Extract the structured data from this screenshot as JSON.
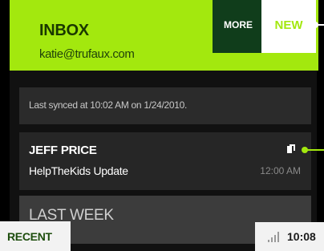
{
  "header": {
    "title": "INBOX",
    "account": "katie@trufaux.com",
    "accent_color": "#a3e80e"
  },
  "actions": {
    "more_label": "MORE",
    "new_label": "NEW"
  },
  "sync": {
    "status_text": "Last synced at 10:02 AM on 1/24/2010."
  },
  "messages": [
    {
      "sender": "JEFF PRICE",
      "subject": "HelpTheKids Update",
      "time": "12:00 AM",
      "icon": "attachment-icon"
    }
  ],
  "section": {
    "label": "LAST WEEK"
  },
  "footer": {
    "recent_label": "RECENT",
    "signal_icon": "signal-strength-icon",
    "clock": "10:08"
  }
}
